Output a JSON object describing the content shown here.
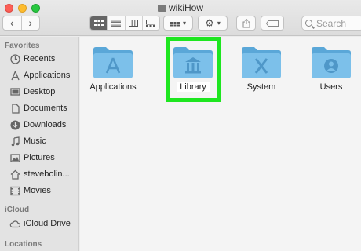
{
  "window": {
    "title": "wikiHow"
  },
  "toolbar": {
    "back_label": "‹",
    "forward_label": "›",
    "search_placeholder": "Search"
  },
  "sidebar": {
    "sections": [
      {
        "title": "Favorites"
      },
      {
        "title": "iCloud"
      },
      {
        "title": "Locations"
      }
    ],
    "favorites": [
      {
        "label": "Recents",
        "icon": "clock-icon"
      },
      {
        "label": "Applications",
        "icon": "applications-icon"
      },
      {
        "label": "Desktop",
        "icon": "desktop-icon"
      },
      {
        "label": "Documents",
        "icon": "document-icon"
      },
      {
        "label": "Downloads",
        "icon": "download-icon"
      },
      {
        "label": "Music",
        "icon": "music-icon"
      },
      {
        "label": "Pictures",
        "icon": "pictures-icon"
      },
      {
        "label": "stevebolin...",
        "icon": "home-icon"
      },
      {
        "label": "Movies",
        "icon": "movies-icon"
      }
    ],
    "icloud": [
      {
        "label": "iCloud Drive",
        "icon": "cloud-icon"
      }
    ]
  },
  "content": {
    "folders": [
      {
        "label": "Applications",
        "icon": "applications-folder-icon"
      },
      {
        "label": "Library",
        "icon": "library-folder-icon",
        "highlighted": true
      },
      {
        "label": "System",
        "icon": "system-folder-icon"
      },
      {
        "label": "Users",
        "icon": "users-folder-icon"
      }
    ]
  },
  "colors": {
    "folder": "#7cc0ea",
    "folder_dark": "#5aa7d8",
    "highlight": "#1ee620"
  }
}
